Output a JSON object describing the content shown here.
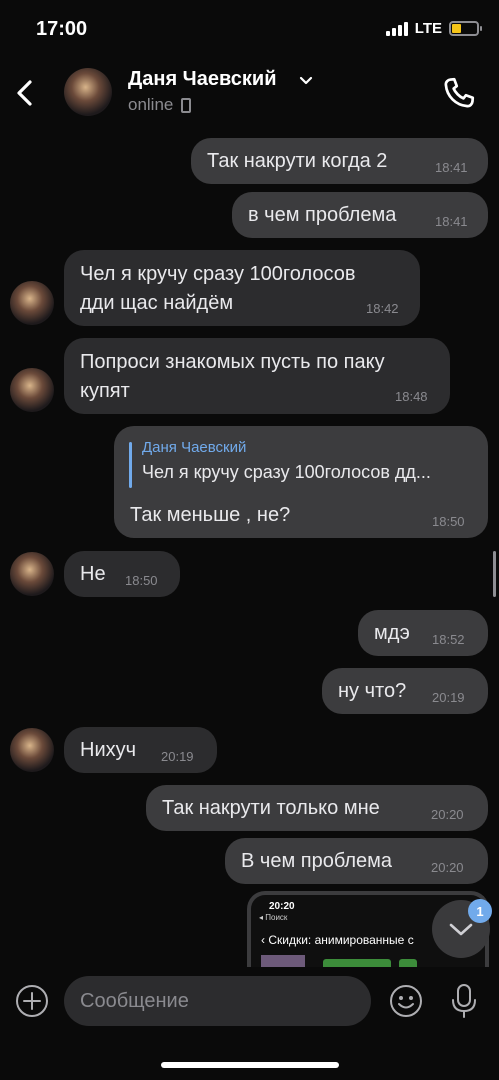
{
  "status_bar": {
    "time": "17:00",
    "network": "LTE"
  },
  "header": {
    "contact_name": "Даня Чаевский",
    "contact_status": "online"
  },
  "messages": [
    {
      "text": "Так накрути когда 2",
      "time": "18:41"
    },
    {
      "text": "в чем проблема",
      "time": "18:41"
    },
    {
      "text_line1": "Чел я кручу сразу 100голосов",
      "text_line2": "дди щас найдём",
      "time": "18:42"
    },
    {
      "text_line1": "Попроси знакомых пусть по паку",
      "text_line2": "купят",
      "time": "18:48"
    },
    {
      "reply_author": "Даня Чаевский",
      "reply_text": "Чел я кручу сразу 100голосов дд...",
      "text": "Так меньше , не?",
      "time": "18:50"
    },
    {
      "text": "Не",
      "time": "18:50"
    },
    {
      "text": "мдэ",
      "time": "18:52"
    },
    {
      "text": "ну что?",
      "time": "20:19"
    },
    {
      "text": "Нихуч",
      "time": "20:19"
    },
    {
      "text": "Так накрути только мне",
      "time": "20:20"
    },
    {
      "text": "В чем проблема",
      "time": "20:20"
    }
  ],
  "attachment": {
    "time": "20:20",
    "back_label": "◂ Поиск",
    "title": "Скидки: анимированные с"
  },
  "unread_badge": "1",
  "composer": {
    "placeholder": "Сообщение"
  },
  "colors": {
    "accent": "#71aaeb",
    "outgoing_bubble": "#3c3c3e",
    "incoming_bubble": "#2c2c2e",
    "background": "#0a0a0a"
  }
}
